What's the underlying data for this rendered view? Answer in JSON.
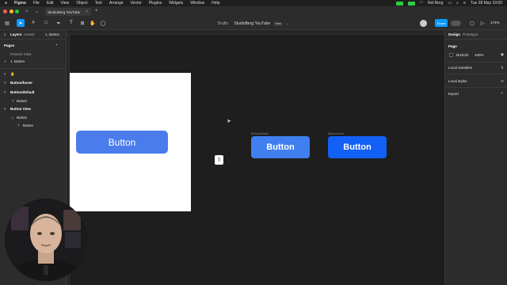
{
  "menubar": {
    "items": [
      "Figma",
      "File",
      "Edit",
      "View",
      "Object",
      "Text",
      "Arrange",
      "Vector",
      "Plugins",
      "Widgets",
      "Window",
      "Help"
    ],
    "user": "Nol Berg",
    "clock": "Tue 28 May  19:00"
  },
  "tab": {
    "title": "StudioBerg YouTube",
    "close": "×"
  },
  "file": {
    "location": "Drafts",
    "name": "StudioBerg YouTube",
    "plan": "Free",
    "caret": "⌄"
  },
  "toolbar": {
    "share": "Share",
    "zoom": "174%"
  },
  "layers_panel": {
    "tabs": [
      "Layers",
      "Assets"
    ],
    "page_selector": "1. Button",
    "pages_title": "Pages",
    "pages": [
      "Present View",
      "1. Button"
    ],
    "layers": [
      "Button/hover",
      "Button/default",
      "Button",
      "Button View",
      "Button",
      "Button"
    ]
  },
  "canvas": {
    "frame_button": "Button",
    "default_label": "Button/default",
    "default_button": "Button",
    "hover_label": "Button/hover",
    "hover_button": "Button"
  },
  "design_panel": {
    "tabs": [
      "Design",
      "Prototype"
    ],
    "page_title": "Page",
    "bg_hex": "1E1E1E",
    "bg_opacity": "100%",
    "sections": [
      "Local variables",
      "Local styles",
      "Export"
    ]
  },
  "colors": {
    "accent": "#0d99ff",
    "button_frame": "#4a7cec",
    "button_default": "#3f7ff0",
    "button_hover": "#1260f5",
    "panel": "#2c2c2c",
    "canvas": "#1e1e1e"
  }
}
